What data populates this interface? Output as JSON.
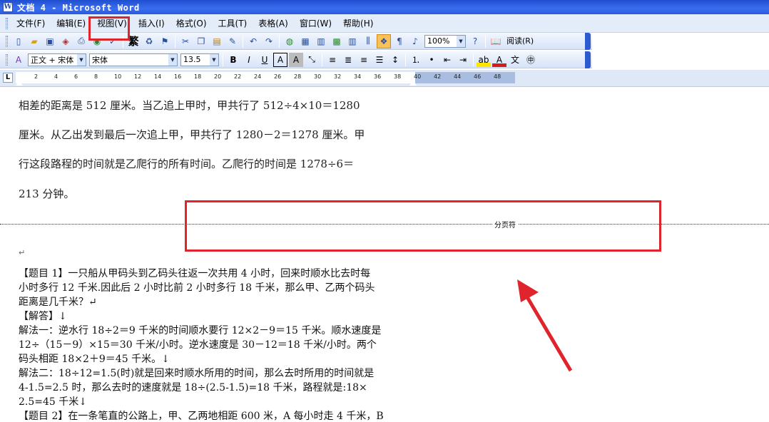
{
  "window": {
    "title": "文档 4 - Microsoft Word",
    "icon": "word-doc-icon"
  },
  "menu": [
    "文件(F)",
    "编辑(E)",
    "视图(V)",
    "插入(I)",
    "格式(O)",
    "工具(T)",
    "表格(A)",
    "窗口(W)",
    "帮助(H)"
  ],
  "toolbar_standard": {
    "zoom": "100%",
    "read_label": "阅读(R)",
    "traditional_label": "繁"
  },
  "toolbar_format": {
    "style": "正文 + 宋体",
    "font": "宋体",
    "size": "13.5"
  },
  "ruler": {
    "ticks": [
      "2",
      "4",
      "6",
      "8",
      "10",
      "12",
      "14",
      "16",
      "18",
      "20",
      "22",
      "24",
      "26",
      "28",
      "30",
      "32",
      "34",
      "36",
      "38",
      "40",
      "42",
      "44",
      "46",
      "48"
    ]
  },
  "document": {
    "lines_top": [
      "相差的距离是 512 厘米。当乙追上甲时，甲共行了 512÷4×10＝1280",
      "厘米。从乙出发到最后一次追上甲，甲共行了 1280－2＝1278 厘米。甲",
      "行这段路程的时间就是乙爬行的所有时间。乙爬行的时间是 1278÷6＝",
      "213 分钟。"
    ],
    "page_break_label": "分页符",
    "paragraph_mark": "↵",
    "lines_bottom": [
      "【题目 1】一只船从甲码头到乙码头往返一次共用 4 小时，回来时顺水比去时每",
      "小时多行 12 千米.因此后 2 小时比前 2 小时多行 18 千米，那么甲、乙两个码头",
      "距离是几千米？↵",
      "【解答】↓",
      "解法一：逆水行 18÷2＝9 千米的时间顺水要行 12×2－9＝15 千米。顺水速度是",
      "12÷（15－9）×15＝30 千米/小时。逆水速度是 30－12＝18 千米/小时。两个",
      "码头相距 18×2＋9＝45 千米。↓",
      "解法二：18÷12=1.5(时)就是回来时顺水所用的时间，那么去时所用的时间就是",
      "4-1.5=2.5 时，那么去时的速度就是 18÷(2.5-1.5)=18 千米，路程就是:18×",
      "2.5=45 千米↓",
      "【题目 2】在一条笔直的公路上，甲、乙两地相距 600 米，A 每小时走 4 千米，B"
    ]
  },
  "annotations": {
    "highlight_color": "#e0242c"
  }
}
